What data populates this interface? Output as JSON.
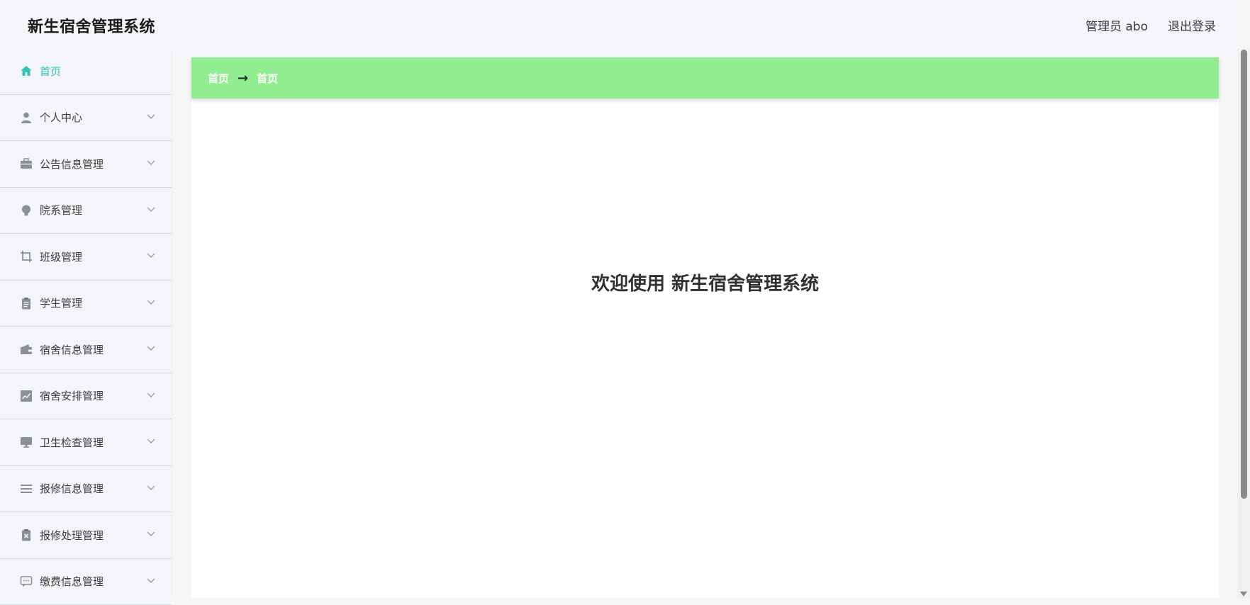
{
  "header": {
    "title": "新生宿舍管理系统",
    "user_label": "管理员 abo",
    "logout_label": "退出登录"
  },
  "sidebar": {
    "items": [
      {
        "label": "首页",
        "icon": "home-icon",
        "active": true
      },
      {
        "label": "个人中心",
        "icon": "user-icon"
      },
      {
        "label": "公告信息管理",
        "icon": "briefcase-icon"
      },
      {
        "label": "院系管理",
        "icon": "lightbulb-icon"
      },
      {
        "label": "班级管理",
        "icon": "crop-icon"
      },
      {
        "label": "学生管理",
        "icon": "clipboard-icon"
      },
      {
        "label": "宿舍信息管理",
        "icon": "wallet-icon"
      },
      {
        "label": "宿舍安排管理",
        "icon": "chart-icon"
      },
      {
        "label": "卫生检查管理",
        "icon": "monitor-icon"
      },
      {
        "label": "报修信息管理",
        "icon": "list-icon"
      },
      {
        "label": "报修处理管理",
        "icon": "clipboard-x-icon"
      },
      {
        "label": "缴费信息管理",
        "icon": "message-icon"
      }
    ]
  },
  "breadcrumb": {
    "first": "首页",
    "second": "首页"
  },
  "main": {
    "welcome": "欢迎使用 新生宿舍管理系统"
  },
  "colors": {
    "accent": "#2ec4b6",
    "breadcrumb_bg": "#90ee90"
  }
}
